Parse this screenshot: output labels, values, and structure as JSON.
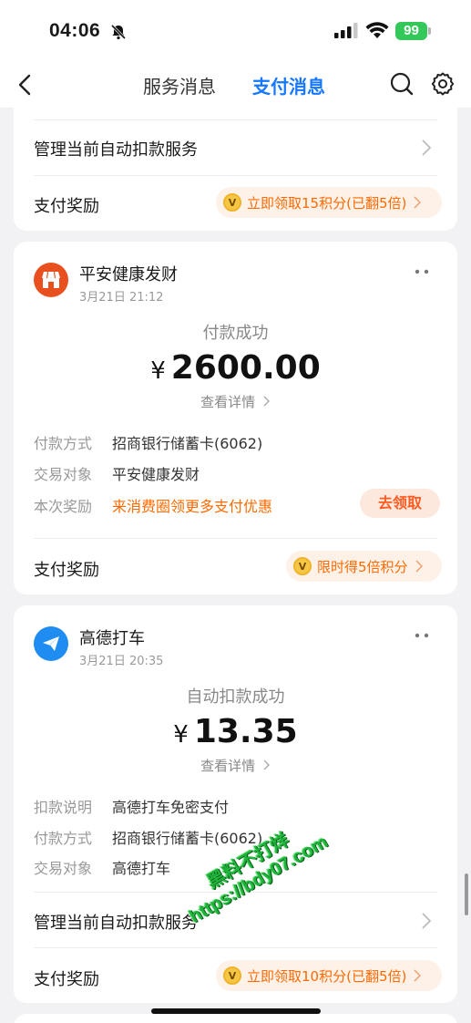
{
  "status_bar": {
    "time": "04:06",
    "battery": "99"
  },
  "nav": {
    "tabs": [
      {
        "label": "服务消息",
        "active": false
      },
      {
        "label": "支付消息",
        "active": true
      }
    ]
  },
  "colors": {
    "accent": "#1677ff",
    "reward_orange": "#ff6a00",
    "pingan_logo": "#e8501f",
    "gaode_logo": "#1e8cf0"
  },
  "card_top": {
    "manage_label": "管理当前自动扣款服务",
    "reward_label": "支付奖励",
    "reward_pill": "立即领取15积分(已翻5倍)"
  },
  "card_pingan": {
    "merchant": "平安健康发财",
    "time": "3月21日 21:12",
    "status": "付款成功",
    "currency": "¥",
    "amount": "2600.00",
    "detail_link": "查看详情",
    "rows": [
      {
        "label": "付款方式",
        "value": "招商银行储蓄卡(6062)"
      },
      {
        "label": "交易对象",
        "value": "平安健康发财"
      },
      {
        "label": "本次奖励",
        "value": "来消费圈领更多支付优惠"
      }
    ],
    "claim_button": "去领取",
    "reward_label": "支付奖励",
    "reward_pill": "限时得5倍积分",
    "icons": {
      "logo": "store-icon",
      "more": "more-dots-icon"
    }
  },
  "card_gaode": {
    "merchant": "高德打车",
    "time": "3月21日 20:35",
    "status": "自动扣款成功",
    "currency": "¥",
    "amount": "13.35",
    "detail_link": "查看详情",
    "rows": [
      {
        "label": "扣款说明",
        "value": "高德打车免密支付"
      },
      {
        "label": "付款方式",
        "value": "招商银行储蓄卡(6062)"
      },
      {
        "label": "交易对象",
        "value": "高德打车"
      }
    ],
    "manage_label": "管理当前自动扣款服务",
    "reward_label": "支付奖励",
    "reward_pill": "立即领取10积分(已翻5倍)",
    "icons": {
      "logo": "paper-plane-icon",
      "more": "more-dots-icon"
    }
  },
  "watermark": {
    "line1": "黑料不打烊",
    "line2": "https://bdy07.com"
  }
}
